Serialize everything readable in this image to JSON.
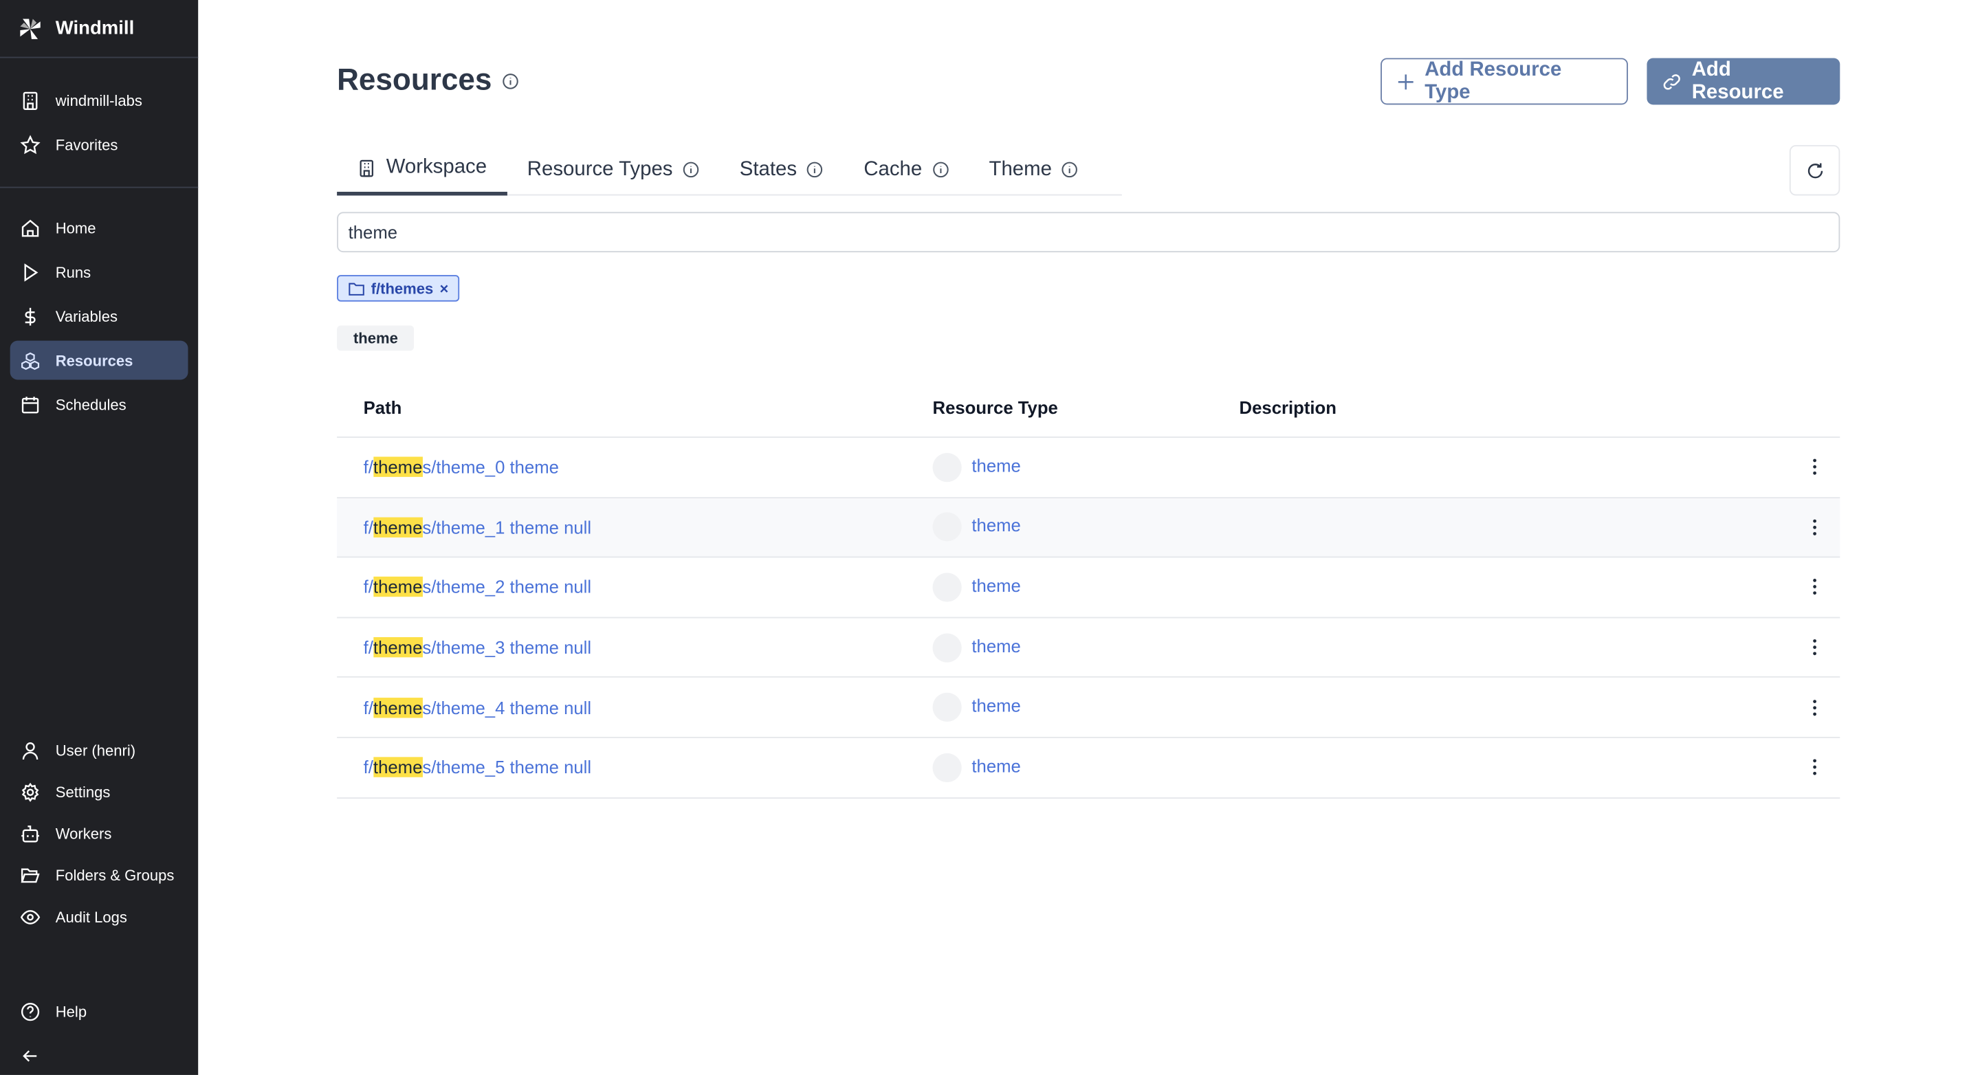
{
  "sidebar": {
    "brand": "Windmill",
    "workspace": "windmill-labs",
    "favorites": "Favorites",
    "nav": [
      {
        "label": "Home",
        "icon": "home-icon"
      },
      {
        "label": "Runs",
        "icon": "play-icon"
      },
      {
        "label": "Variables",
        "icon": "dollar-icon"
      },
      {
        "label": "Resources",
        "icon": "boxes-icon",
        "active": true
      },
      {
        "label": "Schedules",
        "icon": "calendar-icon"
      }
    ],
    "bottom": [
      {
        "label": "User (henri)",
        "icon": "user-icon"
      },
      {
        "label": "Settings",
        "icon": "gear-icon"
      },
      {
        "label": "Workers",
        "icon": "bot-icon"
      },
      {
        "label": "Folders & Groups",
        "icon": "folder-open-icon"
      },
      {
        "label": "Audit Logs",
        "icon": "eye-icon"
      }
    ],
    "help": "Help"
  },
  "header": {
    "title": "Resources",
    "add_resource_type": "Add Resource Type",
    "add_resource": "Add Resource"
  },
  "tabs": [
    "Workspace",
    "Resource Types",
    "States",
    "Cache",
    "Theme"
  ],
  "search": {
    "value": "theme"
  },
  "filter_chip": "f/themes",
  "type_tag": "theme",
  "table": {
    "columns": [
      "Path",
      "Resource Type",
      "Description"
    ],
    "rows": [
      {
        "pre": "f/",
        "match": "theme",
        "post": "s/theme_0 theme",
        "type": "theme"
      },
      {
        "pre": "f/",
        "match": "theme",
        "post": "s/theme_1 theme null",
        "type": "theme"
      },
      {
        "pre": "f/",
        "match": "theme",
        "post": "s/theme_2 theme null",
        "type": "theme"
      },
      {
        "pre": "f/",
        "match": "theme",
        "post": "s/theme_3 theme null",
        "type": "theme"
      },
      {
        "pre": "f/",
        "match": "theme",
        "post": "s/theme_4 theme null",
        "type": "theme"
      },
      {
        "pre": "f/",
        "match": "theme",
        "post": "s/theme_5 theme null",
        "type": "theme"
      }
    ]
  },
  "colors": {
    "sidebar": "#202125",
    "accent": "#6580a8",
    "link": "#4a72d8",
    "highlight": "#fde047"
  }
}
